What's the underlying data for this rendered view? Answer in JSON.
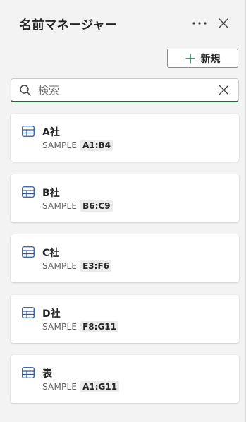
{
  "header": {
    "title": "名前マネージャー",
    "more_icon": "more-horizontal-icon",
    "close_icon": "close-icon"
  },
  "toolbar": {
    "new_label": "新規",
    "new_icon": "plus-icon"
  },
  "search": {
    "placeholder": "検索",
    "value": "",
    "icon": "search-icon",
    "clear_icon": "clear-icon"
  },
  "names": [
    {
      "name": "A社",
      "scope": "SAMPLE",
      "ref": "A1:B4",
      "icon": "table-icon"
    },
    {
      "name": "B社",
      "scope": "SAMPLE",
      "ref": "B6:C9",
      "icon": "table-icon"
    },
    {
      "name": "C社",
      "scope": "SAMPLE",
      "ref": "E3:F6",
      "icon": "table-icon"
    },
    {
      "name": "D社",
      "scope": "SAMPLE",
      "ref": "F8:G11",
      "icon": "table-icon"
    },
    {
      "name": "表",
      "scope": "SAMPLE",
      "ref": "A1:G11",
      "icon": "table-icon"
    }
  ],
  "colors": {
    "accent_green": "#1e6b3a",
    "table_icon_blue": "#2b579a"
  }
}
